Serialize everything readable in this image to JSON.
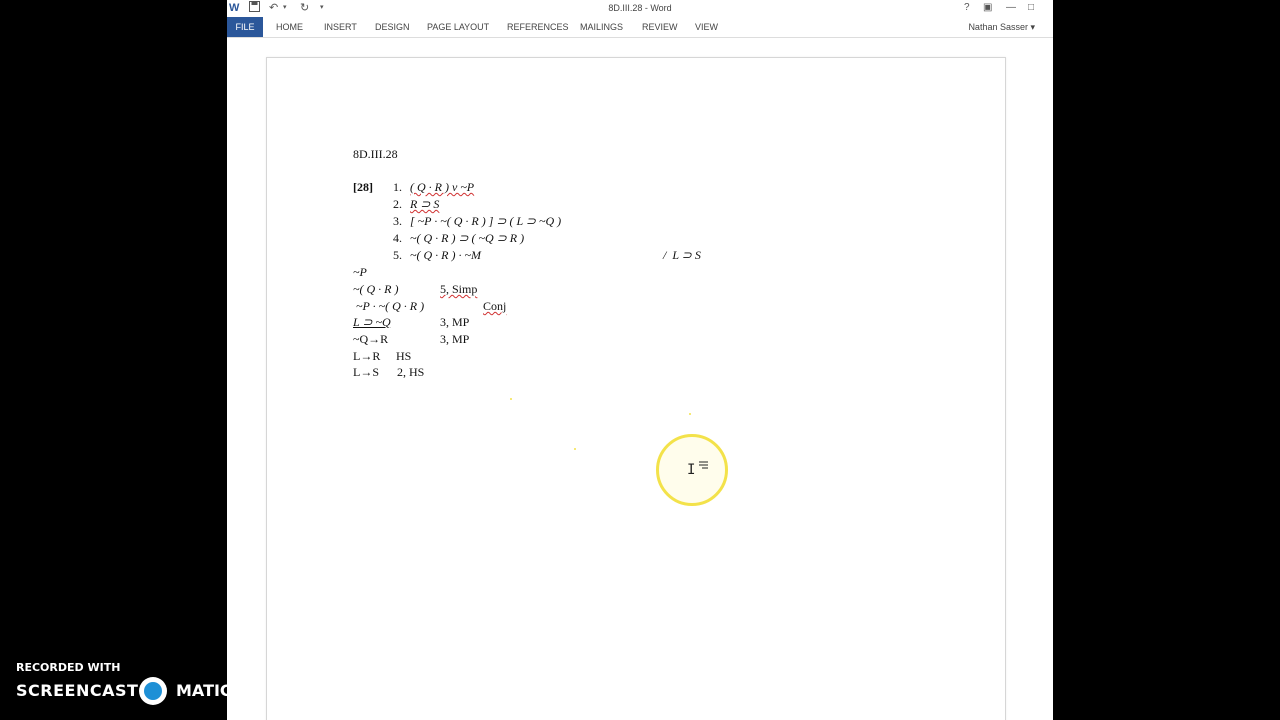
{
  "window": {
    "title": "8D.III.28 - Word",
    "quick_access": [
      "word-logo",
      "save-icon",
      "undo-icon",
      "redo-icon",
      "customize-icon"
    ],
    "controls": {
      "help": "?",
      "restore_ribbon": "▣",
      "minimize": "—",
      "maximize": "□"
    }
  },
  "ribbon": {
    "tabs": [
      "FILE",
      "HOME",
      "INSERT",
      "DESIGN",
      "PAGE LAYOUT",
      "REFERENCES",
      "MAILINGS",
      "REVIEW",
      "VIEW"
    ],
    "user": "Nathan Sasser ▾"
  },
  "document": {
    "heading": "8D.III.28",
    "problem_label": "[28]",
    "premises": [
      {
        "num": "1.",
        "text": "( Q · R ) v ~P"
      },
      {
        "num": "2.",
        "text": "R ⊃ S"
      },
      {
        "num": "3.",
        "text": "[ ~P · ~( Q · R ) ] ⊃ ( L ⊃ ~Q )"
      },
      {
        "num": "4.",
        "text": "~( Q · R ) ⊃ ( ~Q ⊃ R )"
      },
      {
        "num": "5.",
        "text": "~( Q · R ) · ~M"
      }
    ],
    "conclusion": "/  L ⊃ S",
    "steps": [
      {
        "formula": "~P",
        "justification": ""
      },
      {
        "formula": "~( Q · R )",
        "justification": "5, Simp"
      },
      {
        "formula": " ~P · ~( Q · R )",
        "justification": "Conj"
      },
      {
        "formula": "L ⊃ ~Q",
        "justification": "3, MP"
      },
      {
        "formula": "~Q→R",
        "justification": "3, MP"
      },
      {
        "formula": "L→R",
        "justification": "HS"
      },
      {
        "formula": "L→S",
        "justification": "2, HS"
      }
    ]
  },
  "watermark": {
    "line1": "RECORDED WITH",
    "line2a": "SCREENCAST",
    "line2b": "MATIC"
  }
}
